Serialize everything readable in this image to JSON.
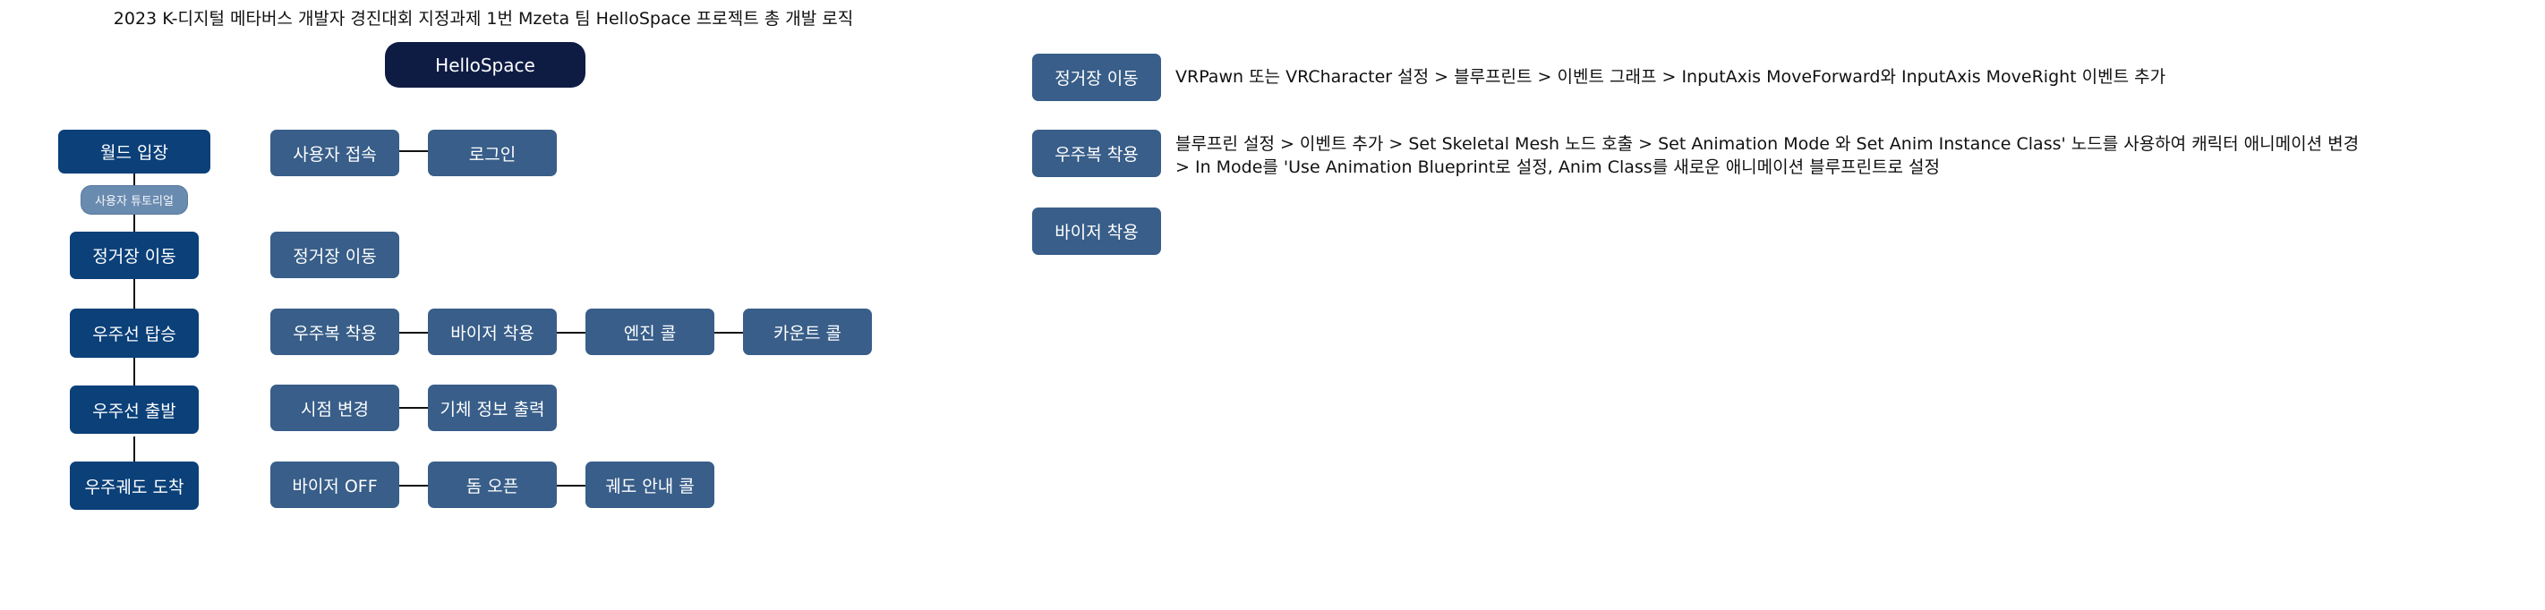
{
  "title": "2023 K-디지털 메타버스 개발자 경진대회 지정과제 1번 Mzeta 팀 HelloSpace 프로젝트 총 개발 로직",
  "root": "HelloSpace",
  "stages": {
    "world_entry": "월드 입장",
    "user_tutorial": "사용자 튜토리얼",
    "station_move": "정거장 이동",
    "ship_board": "우주선 탑승",
    "ship_depart": "우주선 출발",
    "orbit_arrive": "우주궤도 도착"
  },
  "steps": {
    "user_connect": "사용자 접속",
    "login": "로그인",
    "station_move": "정거장 이동",
    "wear_suit": "우주복 착용",
    "wear_visor": "바이저 착용",
    "engine_call": "엔진 콜",
    "count_call": "카운트 콜",
    "view_change": "시점 변경",
    "craft_info": "기체 정보 출력",
    "visor_off": "바이저 OFF",
    "dome_open": "돔 오픈",
    "orbit_guide": "궤도 안내 콜"
  },
  "notes": [
    {
      "label": "정거장 이동",
      "lines": [
        "VRPawn 또는 VRCharacter 설정 > 블루프린트 > 이벤트 그래프 > InputAxis MoveForward와 InputAxis MoveRight 이벤트 추가"
      ]
    },
    {
      "label": "우주복 착용",
      "lines": [
        "블루프린 설정 > 이벤트 추가 > Set Skeletal Mesh 노드 호출 > Set Animation Mode 와 Set Anim Instance Class' 노드를 사용하여 캐릭터 애니메이션 변경",
        "> In Mode를 'Use Animation Blueprint로 설정, Anim Class를 새로운 애니메이션 블루프린트로 설정"
      ]
    },
    {
      "label": "바이저 착용",
      "lines": []
    }
  ]
}
